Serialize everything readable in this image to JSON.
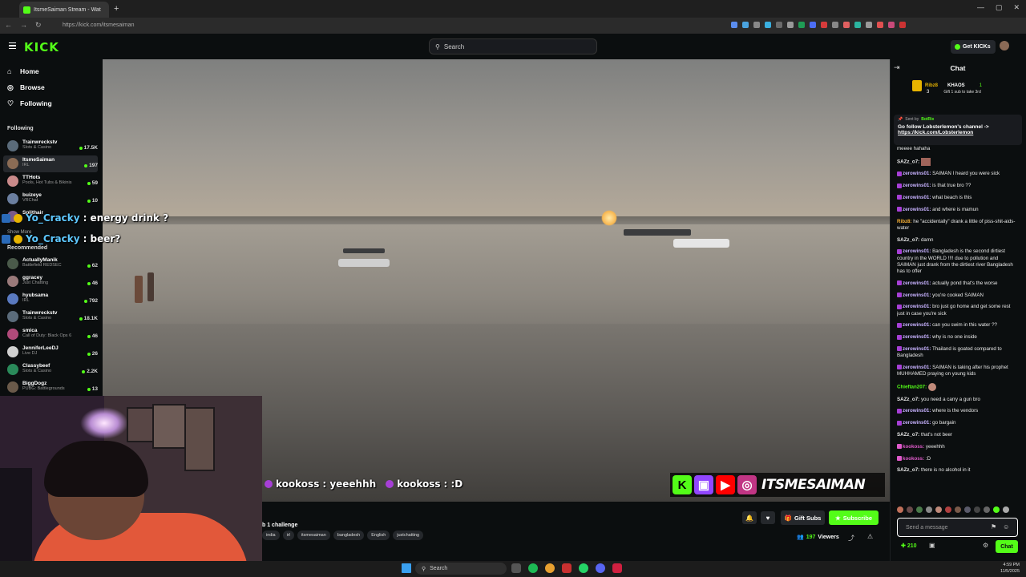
{
  "browser": {
    "tab_title": "ItsmeSaiman Stream - Wat",
    "url": "https://kick.com/itsmesaiman"
  },
  "header": {
    "logo": "KICK",
    "search_placeholder": "Search",
    "get_kicks": "Get KICKs"
  },
  "sidebar": {
    "nav": [
      {
        "label": "Home"
      },
      {
        "label": "Browse"
      },
      {
        "label": "Following"
      }
    ],
    "following_title": "Following",
    "following": [
      {
        "name": "Trainwreckstv",
        "category": "Slots & Casino",
        "viewers": "17.5K"
      },
      {
        "name": "ItsmeSaiman",
        "category": "IRL",
        "viewers": "197"
      },
      {
        "name": "TTHots",
        "category": "Pools, Hot Tubs & Bikinis",
        "viewers": "59"
      },
      {
        "name": "buizeye",
        "category": "VRChat",
        "viewers": "10"
      },
      {
        "name": "Splithair",
        "category": "",
        "viewers": ""
      }
    ],
    "show_more": "Show More",
    "recommended_title": "Recommended",
    "recommended": [
      {
        "name": "ActuallyManik",
        "category": "Battlefield REDSEC",
        "viewers": "62"
      },
      {
        "name": "ggracey",
        "category": "Just Chatting",
        "viewers": "46"
      },
      {
        "name": "hyubsama",
        "category": "IRL",
        "viewers": "792"
      },
      {
        "name": "Trainwreckstv",
        "category": "Slots & Casino",
        "viewers": "18.1K"
      },
      {
        "name": "smica",
        "category": "Call of Duty: Black Ops 6",
        "viewers": "46"
      },
      {
        "name": "JenniferLeeDJ",
        "category": "Live DJ",
        "viewers": "26"
      },
      {
        "name": "Classybeef",
        "category": "Slots & Casino",
        "viewers": "2.2K"
      },
      {
        "name": "BiggDogz",
        "category": "PUBG: Battlegrounds",
        "viewers": "13"
      }
    ]
  },
  "overlay": {
    "chat_lines": [
      {
        "user": "Yo_Cracky",
        "text": " : energy drink ?"
      },
      {
        "user": "Yo_Cracky",
        "text": " : beer?"
      }
    ],
    "bottom_chat": [
      {
        "user": "kookoss",
        "text": " : yeeehhh"
      },
      {
        "user": "kookoss",
        "text": " : :D"
      }
    ],
    "brand": "ITSMESAIMAN"
  },
  "stream": {
    "title_fragment": "b 1 challenge",
    "tags": [
      "india",
      "irl",
      "itsmesaiman",
      "bangladesh",
      "English",
      "justchatting"
    ],
    "gift_subs": "Gift Subs",
    "subscribe": "Subscribe",
    "viewers": "197",
    "viewers_label": "Viewers"
  },
  "chat": {
    "title": "Chat",
    "gift_leader": {
      "name": "Ribz8",
      "count": "3",
      "second": "KHAOS",
      "second_count": "1",
      "note": "Gift 1 sub to take 3rd"
    },
    "pinned": {
      "sent_by": "Sent by",
      "bot": "BotRix",
      "text": "Go follow Lobsterlemon's channel ->",
      "link": "https://kick.com/Lobsterlemon"
    },
    "messages": [
      {
        "user": "",
        "text": "meeee hahaha"
      },
      {
        "user": "SAZz_o7:",
        "text": ""
      },
      {
        "user": "zerowins01:",
        "text": "SAIMAN I heard you were sick"
      },
      {
        "user": "zerowins01:",
        "text": "is that true bro ??"
      },
      {
        "user": "zerowins01:",
        "text": "what beach is this"
      },
      {
        "user": "zerowins01:",
        "text": "and where is mamun"
      },
      {
        "user": "Ribz8:",
        "text": "he \"accidentally\" drank a little of piss-shit-aids-water"
      },
      {
        "user": "SAZz_o7:",
        "text": "damn"
      },
      {
        "user": "zerowins01:",
        "text": "Bangladesh is the second dirtiest country in the WORLD !!!! due to pollution and SAIMAN just drank from the dirtiest river Bangladesh has to offer"
      },
      {
        "user": "zerowins01:",
        "text": "actually pond that's the worse"
      },
      {
        "user": "zerowins01:",
        "text": "you're cooked SAIMAN"
      },
      {
        "user": "zerowins01:",
        "text": "bro just go home and get some rest just in case you're sick"
      },
      {
        "user": "zerowins01:",
        "text": "can you swim in this water ??"
      },
      {
        "user": "zerowins01:",
        "text": "why is no one inside"
      },
      {
        "user": "zerowins01:",
        "text": "Thailand is goated compared to Bangladesh"
      },
      {
        "user": "zerowins01:",
        "text": "SAIMAN is taking after his prophet MUHHAMED praying on young kids"
      },
      {
        "user": "Chieftan207:",
        "text": ""
      },
      {
        "user": "SAZz_o7:",
        "text": "you need a carry a gun bro"
      },
      {
        "user": "zerowins01:",
        "text": "where is the vendors"
      },
      {
        "user": "zerowins01:",
        "text": "go bargain"
      },
      {
        "user": "SAZz_o7:",
        "text": "that's not beer"
      },
      {
        "user": "kookoss:",
        "text": "yeeehhh"
      },
      {
        "user": "kookoss:",
        "text": ":D"
      },
      {
        "user": "SAZz_o7:",
        "text": "there is no alcohol in it"
      }
    ],
    "input_placeholder": "Send a message",
    "points": "210",
    "send": "Chat"
  },
  "taskbar": {
    "search": "Search",
    "time": "4:59 PM",
    "date": "11/5/2025"
  }
}
